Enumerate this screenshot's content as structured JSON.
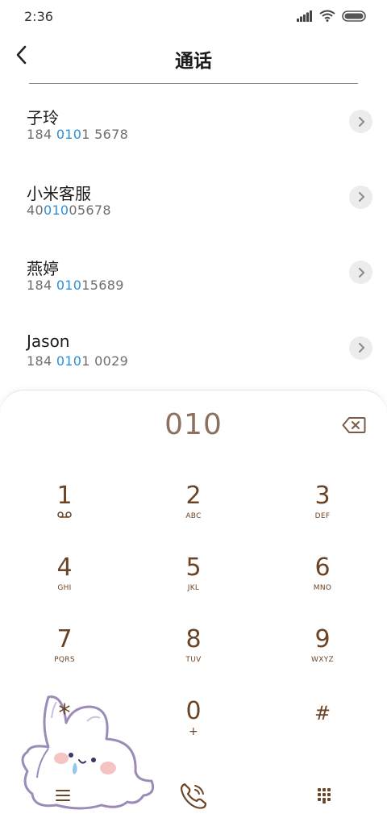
{
  "status": {
    "time": "2:36"
  },
  "header": {
    "title": "通话"
  },
  "results": [
    {
      "name": "子玲",
      "number_pre": "184 ",
      "number_hl": "010",
      "number_post": "1 5678"
    },
    {
      "name": "小米客服",
      "number_pre": "40",
      "number_hl": "010",
      "number_post": "05678"
    },
    {
      "name": "燕婷",
      "number_pre": "184 ",
      "number_hl": "010",
      "number_post": "15689"
    },
    {
      "name": "Jason",
      "number_pre": "184 ",
      "number_hl": "010",
      "number_post": "1 0029"
    }
  ],
  "dialpad": {
    "entry": "010",
    "keys": [
      {
        "digit": "1",
        "letters": ""
      },
      {
        "digit": "2",
        "letters": "ABC"
      },
      {
        "digit": "3",
        "letters": "DEF"
      },
      {
        "digit": "4",
        "letters": "GHI"
      },
      {
        "digit": "5",
        "letters": "JKL"
      },
      {
        "digit": "6",
        "letters": "MNO"
      },
      {
        "digit": "7",
        "letters": "PQRS"
      },
      {
        "digit": "8",
        "letters": "TUV"
      },
      {
        "digit": "9",
        "letters": "WXYZ"
      },
      {
        "digit": "*",
        "letters": ""
      },
      {
        "digit": "0",
        "letters": "+"
      },
      {
        "digit": "#",
        "letters": ""
      }
    ]
  },
  "colors": {
    "highlight": "#2f8fd8",
    "key_text": "#6b4426",
    "entry_text": "#8b7060"
  },
  "icons": {
    "back": "chevron-left-icon",
    "row_action": "chevron-right-icon",
    "backspace": "backspace-icon",
    "voicemail": "voicemail-icon",
    "menu": "menu-icon",
    "call": "phone-call-icon",
    "keypad": "dialpad-grid-icon"
  }
}
